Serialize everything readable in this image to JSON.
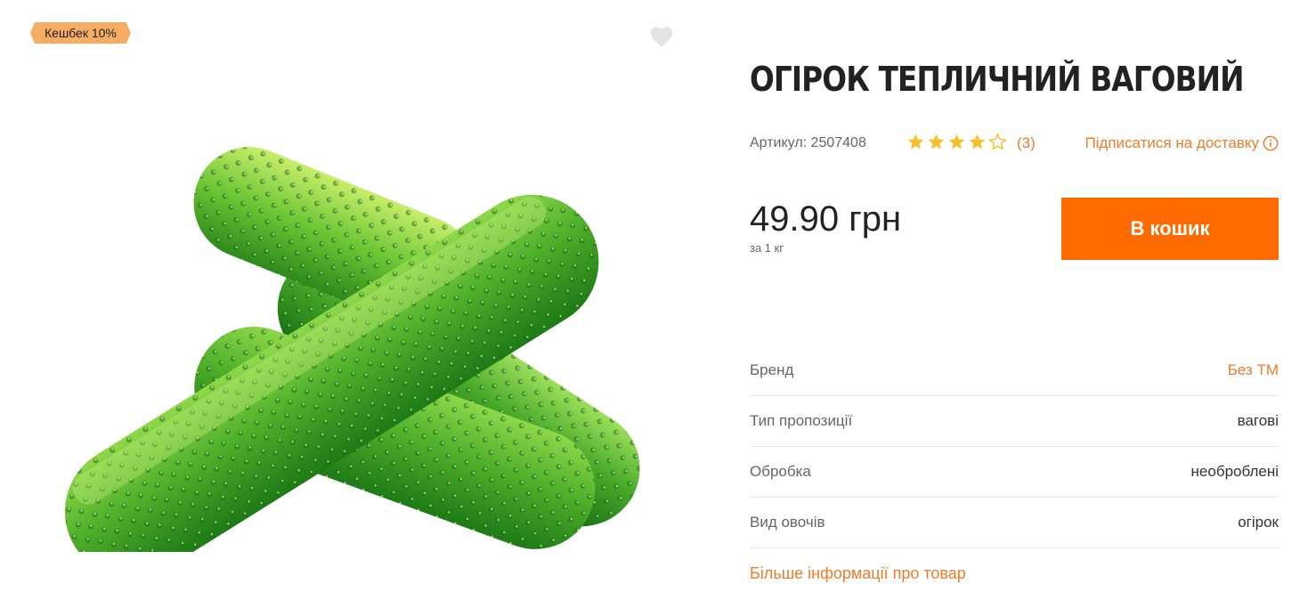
{
  "badge": {
    "cashback": "Кешбек 10%"
  },
  "product": {
    "title": "ОГІРОК ТЕПЛИЧНИЙ ВАГОВИЙ",
    "sku_label": "Артикул:",
    "sku": "2507408",
    "rating": 4,
    "rating_max": 5,
    "reviews": "(3)",
    "subscribe": "Підписатися на доставку",
    "price": "49.90 грн",
    "unit": "за 1 кг",
    "cart_button": "В кошик",
    "more_info": "Більше інформації про товар"
  },
  "attributes": [
    {
      "key": "Бренд",
      "value": "Без ТМ"
    },
    {
      "key": "Тип пропозиції",
      "value": "вагові"
    },
    {
      "key": "Обробка",
      "value": "необроблені"
    },
    {
      "key": "Вид овочів",
      "value": "огірок"
    }
  ],
  "colors": {
    "accent": "#ff6b00",
    "link": "#ef7b2b",
    "star": "#f6c02c",
    "badge": "#f4ad63"
  },
  "icons": {
    "favorite": "heart-icon",
    "info": "info-icon",
    "star": "star-icon"
  }
}
